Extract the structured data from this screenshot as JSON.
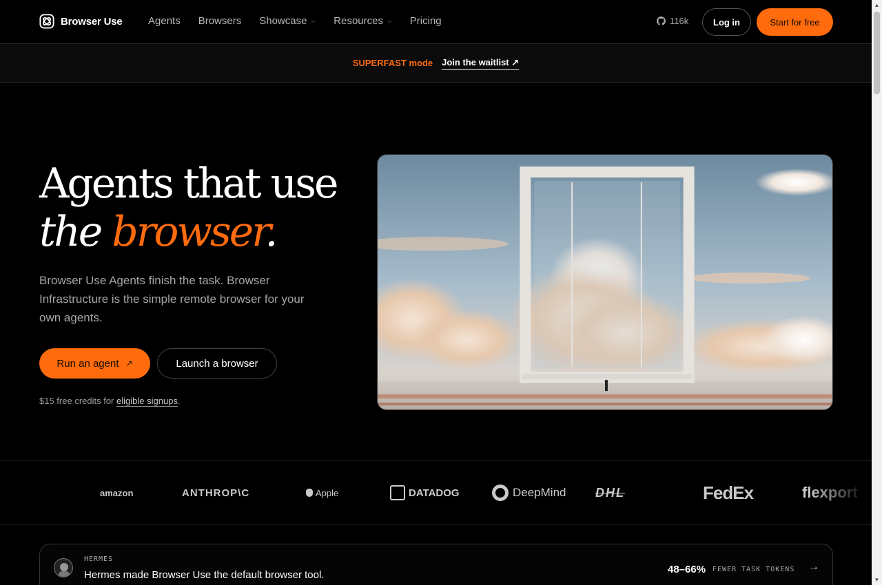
{
  "nav": {
    "brand": "Browser Use",
    "links": [
      {
        "label": "Agents",
        "dropdown": false
      },
      {
        "label": "Browsers",
        "dropdown": false
      },
      {
        "label": "Showcase",
        "dropdown": true
      },
      {
        "label": "Resources",
        "dropdown": true
      },
      {
        "label": "Pricing",
        "dropdown": false
      }
    ],
    "github_stars": "116k",
    "login_label": "Log in",
    "start_label": "Start for free"
  },
  "banner": {
    "mode": "SUPERFAST mode",
    "link": "Join the waitlist ↗"
  },
  "hero": {
    "title_line1": "Agents that use",
    "title_line2_a": "the",
    "title_line2_accent": "browser",
    "title_line2_end": ".",
    "description": "Browser Use Agents finish the task. Browser Infrastructure is the simple remote browser for your own agents.",
    "run_label": "Run an agent",
    "run_icon": "↗",
    "launch_label": "Launch a browser",
    "credits_prefix": "$15 free credits for",
    "credits_link": "eligible signups",
    "credits_suffix": "."
  },
  "logos": [
    "amazon",
    "ANTHROP\\C",
    "Apple",
    "DATADOG",
    "DeepMind",
    "DHL",
    "FedEx",
    "flexport"
  ],
  "card": {
    "eyebrow": "HERMES",
    "text": "Hermes made Browser Use the default browser tool.",
    "stat": "48–66%",
    "stat_label": "FEWER TASK TOKENS",
    "arrow": "→"
  },
  "colors": {
    "accent": "#ff6b0d",
    "background": "#000000"
  }
}
